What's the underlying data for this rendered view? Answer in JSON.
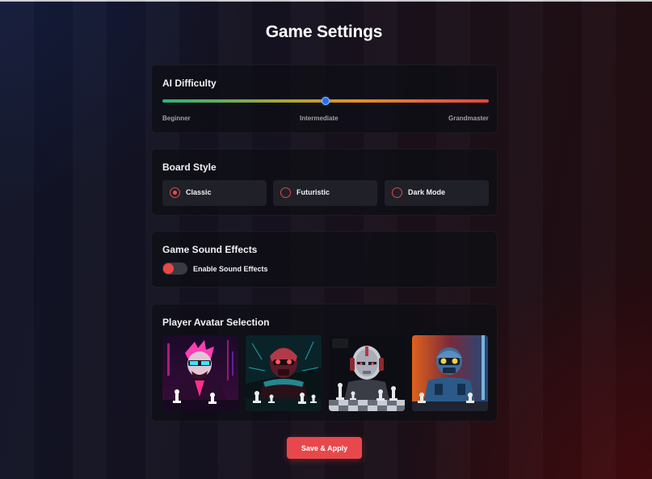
{
  "page": {
    "title": "Game Settings"
  },
  "difficulty": {
    "title": "AI Difficulty",
    "labels": [
      "Beginner",
      "Intermediate",
      "Grandmaster"
    ],
    "value": 0.5
  },
  "board_style": {
    "title": "Board Style",
    "options": [
      {
        "label": "Classic",
        "selected": true
      },
      {
        "label": "Futuristic",
        "selected": false
      },
      {
        "label": "Dark Mode",
        "selected": false
      }
    ]
  },
  "sound": {
    "title": "Game Sound Effects",
    "toggle_label": "Enable Sound Effects",
    "enabled": false
  },
  "avatars": {
    "title": "Player Avatar Selection",
    "items": [
      {
        "icon": "neon-pink-chess-player-avatar"
      },
      {
        "icon": "teal-cyborg-chess-player-avatar"
      },
      {
        "icon": "silver-robot-chess-player-avatar"
      },
      {
        "icon": "orange-blue-robot-chess-player-avatar"
      }
    ]
  },
  "actions": {
    "save_label": "Save & Apply"
  },
  "colors": {
    "accent": "#e8484c",
    "thumb": "#2f6ee0"
  }
}
